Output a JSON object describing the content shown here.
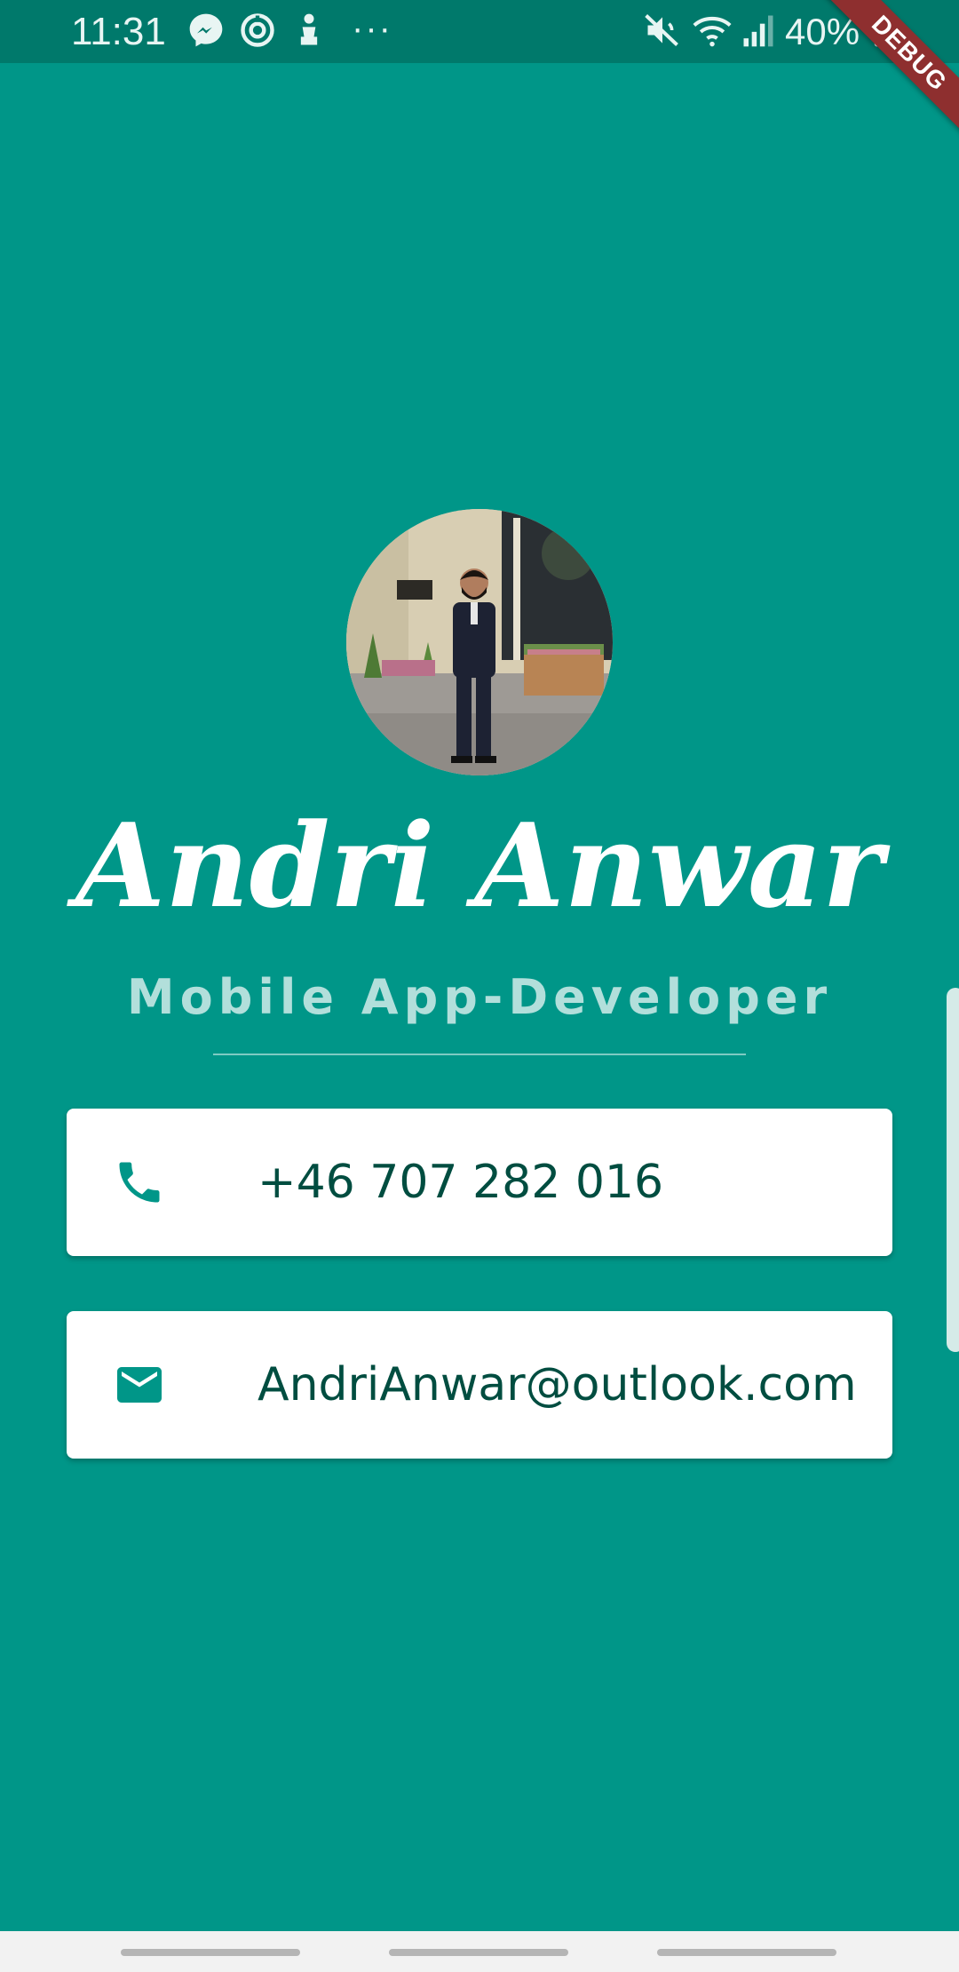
{
  "status_bar": {
    "time": "11:31",
    "more_indicator": "···",
    "battery_percent": "40%",
    "icons": [
      "messenger-icon",
      "sync-icon",
      "notification-app-icon",
      "mute-icon",
      "wifi-icon",
      "signal-icon",
      "battery-icon"
    ]
  },
  "debug_banner": {
    "label": "DEBUG"
  },
  "profile": {
    "name": "Andri Anwar",
    "role": "Mobile App-Developer"
  },
  "contacts": {
    "phone": "+46 707 282 016",
    "email": "AndriAnwar@outlook.com"
  },
  "colors": {
    "background": "#009688",
    "status_bar": "#00796b",
    "card": "#ffffff",
    "icon": "#009688",
    "text": "#004d40",
    "role_text": "#b2dfdb"
  }
}
